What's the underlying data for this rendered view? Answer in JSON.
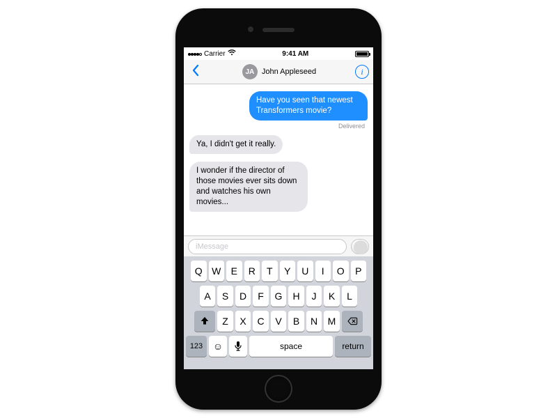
{
  "statusbar": {
    "carrier": "Carrier",
    "time": "9:41 AM"
  },
  "header": {
    "contact_initials": "JA",
    "contact_name": "John Appleseed"
  },
  "messages": {
    "m0": "Have you seen that newest Transformers movie?",
    "m0_status": "Delivered",
    "m1": "Ya, I didn't get it really.",
    "m2": "I wonder if the director of those movies ever sits down and watches his own movies..."
  },
  "input": {
    "placeholder": "iMessage"
  },
  "keyboard": {
    "row1": [
      "Q",
      "W",
      "E",
      "R",
      "T",
      "Y",
      "U",
      "I",
      "O",
      "P"
    ],
    "row2": [
      "A",
      "S",
      "D",
      "F",
      "G",
      "H",
      "J",
      "K",
      "L"
    ],
    "row3": [
      "Z",
      "X",
      "C",
      "V",
      "B",
      "N",
      "M"
    ],
    "numkey": "123",
    "space": "space",
    "return": "return"
  }
}
